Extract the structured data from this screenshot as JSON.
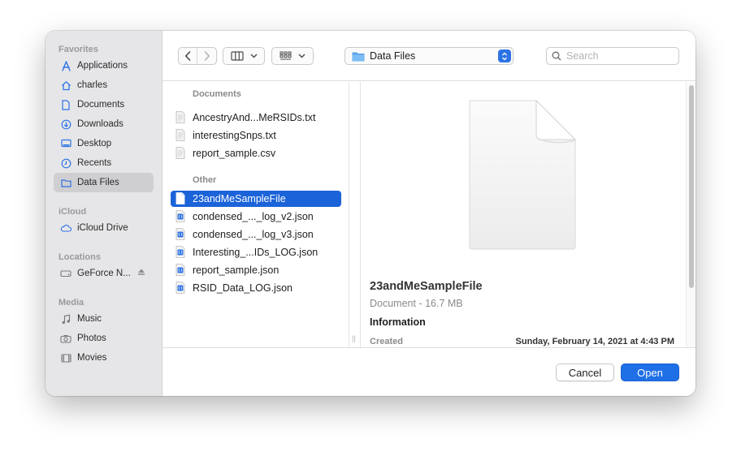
{
  "sidebar": {
    "sections": [
      {
        "title": "Favorites",
        "items": [
          {
            "label": "Applications",
            "icon": "applications-icon"
          },
          {
            "label": "charles",
            "icon": "home-icon"
          },
          {
            "label": "Documents",
            "icon": "document-icon"
          },
          {
            "label": "Downloads",
            "icon": "downloads-icon"
          },
          {
            "label": "Desktop",
            "icon": "desktop-icon"
          },
          {
            "label": "Recents",
            "icon": "clock-icon"
          },
          {
            "label": "Data Files",
            "icon": "folder-icon",
            "selected": true
          }
        ]
      },
      {
        "title": "iCloud",
        "items": [
          {
            "label": "iCloud Drive",
            "icon": "cloud-icon"
          }
        ]
      },
      {
        "title": "Locations",
        "items": [
          {
            "label": "GeForce N...",
            "icon": "drive-icon",
            "eject": true
          }
        ]
      },
      {
        "title": "Media",
        "items": [
          {
            "label": "Music",
            "icon": "music-icon"
          },
          {
            "label": "Photos",
            "icon": "camera-icon"
          },
          {
            "label": "Movies",
            "icon": "film-icon"
          }
        ]
      }
    ]
  },
  "toolbar": {
    "location": "Data Files",
    "search_placeholder": "Search"
  },
  "filelist": {
    "groups": [
      {
        "title": "Documents",
        "files": [
          {
            "name": "AncestryAnd...MeRSIDs.txt",
            "type": "text"
          },
          {
            "name": "interestingSnps.txt",
            "type": "text"
          },
          {
            "name": "report_sample.csv",
            "type": "text"
          }
        ]
      },
      {
        "title": "Other",
        "files": [
          {
            "name": "23andMeSampleFile",
            "type": "doc",
            "selected": true
          },
          {
            "name": "condensed_..._log_v2.json",
            "type": "json"
          },
          {
            "name": "condensed_..._log_v3.json",
            "type": "json"
          },
          {
            "name": "Interesting_...IDs_LOG.json",
            "type": "json"
          },
          {
            "name": "report_sample.json",
            "type": "json"
          },
          {
            "name": "RSID_Data_LOG.json",
            "type": "json"
          }
        ]
      }
    ]
  },
  "preview": {
    "name": "23andMeSampleFile",
    "kind": "Document - 16.7 MB",
    "info_header": "Information",
    "created_label": "Created",
    "created_value": "Sunday, February 14, 2021 at 4:43 PM"
  },
  "buttons": {
    "cancel": "Cancel",
    "open": "Open"
  },
  "colors": {
    "accent": "#1f6fe6",
    "selection": "#1b63d8",
    "sidebar_bg": "#e6e6e8"
  }
}
